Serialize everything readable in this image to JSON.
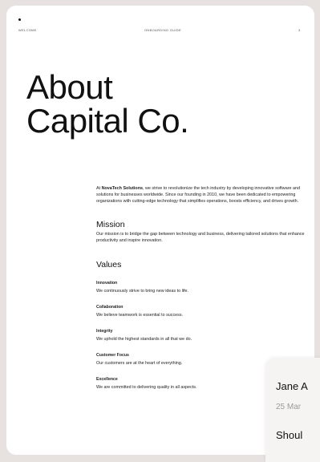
{
  "header": {
    "left": "WELCOME",
    "center": "ONBOARDING GUIDE",
    "page_number": "3"
  },
  "title_line1": "About",
  "title_line2": "Capital Co.",
  "intro": {
    "company": "NovaTech Solutions",
    "text": ", we strive to revolutionize the tech industry by developing innovative software and solutions for businesses worldwide. Since our founding in 2010, we have been dedicated to empowering organizations with cutting-edge technology that simplifies operations, boosts efficiency, and drives growth.",
    "prefix": "At "
  },
  "mission": {
    "heading": "Mission",
    "text": "Our mission is to bridge the gap between technology and business, delivering tailored solutions that enhance productivity and inspire innovation."
  },
  "values": {
    "heading": "Values",
    "items": [
      {
        "name": "Innovation",
        "desc": "We continuously strive to bring new ideas to life."
      },
      {
        "name": "Collaboration",
        "desc": "We believe teamwork is essential to success."
      },
      {
        "name": "Integrity",
        "desc": "We uphold the highest standards in all that we do."
      },
      {
        "name": "Customer Focus",
        "desc": "Our customers are at the heart of everything."
      },
      {
        "name": "Excellence",
        "desc": "We are committed to delivering quality in all aspects."
      }
    ]
  },
  "comment_card": {
    "author": "Jane A",
    "date": "25 Mar",
    "text": "Shoul"
  }
}
